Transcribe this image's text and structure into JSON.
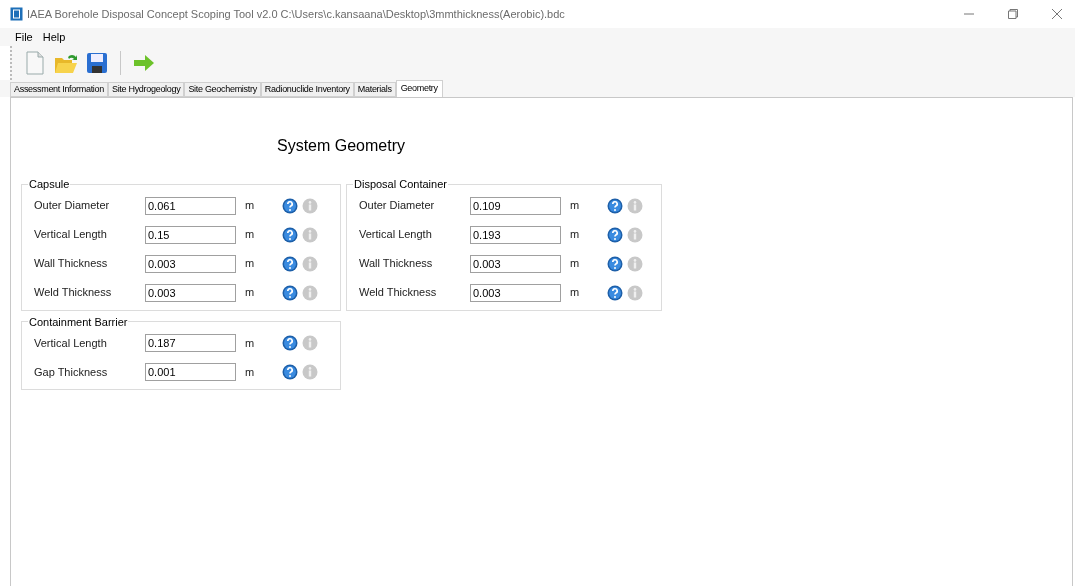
{
  "window": {
    "title": "IAEA Borehole Disposal Concept Scoping Tool v2.0 C:\\Users\\c.kansaana\\Desktop\\3mmthickness(Aerobic).bdc"
  },
  "menu": [
    "File",
    "Help"
  ],
  "toolbar": [
    {
      "kind": "new"
    },
    {
      "kind": "open"
    },
    {
      "kind": "save"
    },
    {
      "kind": "separator"
    },
    {
      "kind": "run"
    }
  ],
  "tabs": [
    {
      "label": "Assessment Information",
      "selected": false
    },
    {
      "label": "Site Hydrogeology",
      "selected": false
    },
    {
      "label": "Site Geochemistry",
      "selected": false
    },
    {
      "label": "Radionuclide Inventory",
      "selected": false
    },
    {
      "label": "Materials",
      "selected": false
    },
    {
      "label": "Geometry",
      "selected": true
    }
  ],
  "heading": "System Geometry",
  "columns": [
    {
      "groups": [
        {
          "title": "Capsule",
          "fields": [
            {
              "label": "Outer Diameter",
              "value": "0.061",
              "unit": "m",
              "info_enabled": false
            },
            {
              "label": "Vertical Length",
              "value": "0.15",
              "unit": "m",
              "info_enabled": false
            },
            {
              "label": "Wall Thickness",
              "value": "0.003",
              "unit": "m",
              "info_enabled": false
            },
            {
              "label": "Weld Thickness",
              "value": "0.003",
              "unit": "m",
              "info_enabled": false
            }
          ]
        },
        {
          "title": "Containment Barrier",
          "fields": [
            {
              "label": "Vertical Length",
              "value": "0.187",
              "unit": "m",
              "info_enabled": false
            },
            {
              "label": "Gap Thickness",
              "value": "0.001",
              "unit": "m",
              "info_enabled": false
            }
          ]
        }
      ]
    },
    {
      "groups": [
        {
          "title": "Disposal Container",
          "fields": [
            {
              "label": "Outer Diameter",
              "value": "0.109",
              "unit": "m",
              "info_enabled": false
            },
            {
              "label": "Vertical Length",
              "value": "0.193",
              "unit": "m",
              "info_enabled": false
            },
            {
              "label": "Wall Thickness",
              "value": "0.003",
              "unit": "m",
              "info_enabled": false
            },
            {
              "label": "Weld Thickness",
              "value": "0.003",
              "unit": "m",
              "info_enabled": false
            }
          ]
        }
      ]
    }
  ]
}
